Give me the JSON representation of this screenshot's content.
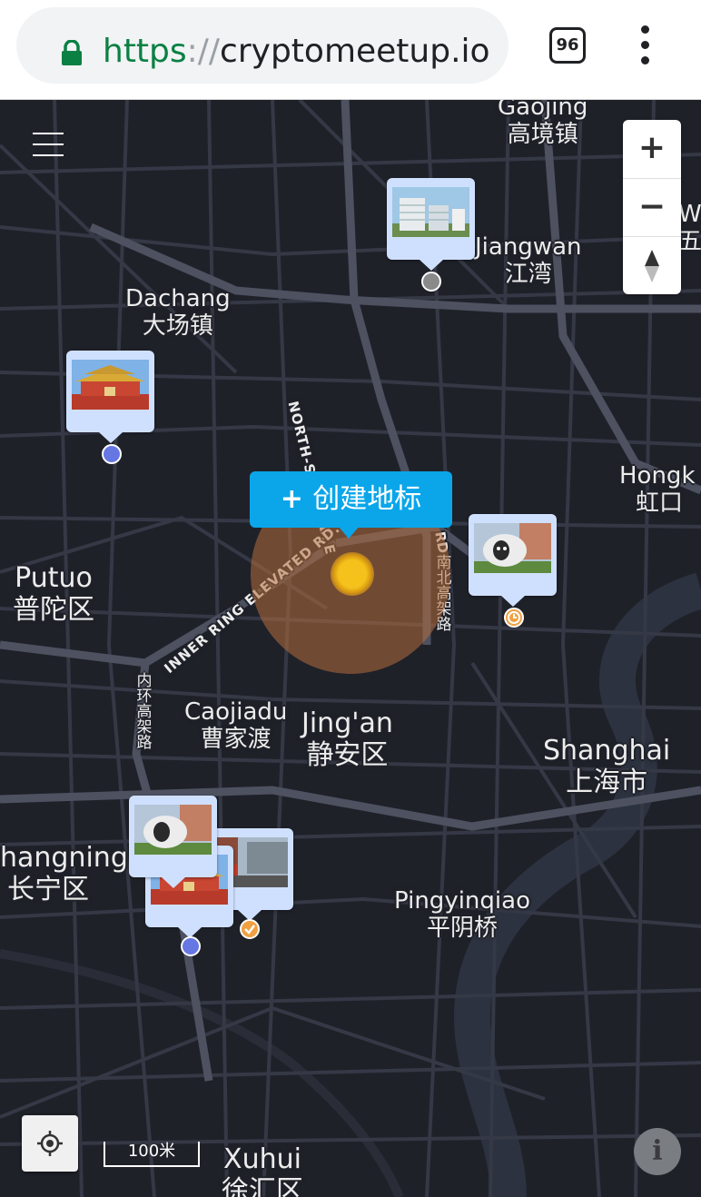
{
  "browser": {
    "url_scheme": "https",
    "url_sep": "://",
    "url_host": "cryptomeetup.io",
    "tab_count": "96"
  },
  "map": {
    "labels": {
      "gaojing_en": "Gaojing",
      "gaojing_zh": "高境镇",
      "jiangwan_en": "Jiangwan",
      "jiangwan_zh": "江湾",
      "dachang_en": "Dachang",
      "dachang_zh": "大场镇",
      "hongkou_en": "Hongk",
      "hongkou_zh": "虹口",
      "putuo_en": "Putuo",
      "putuo_zh": "普陀区",
      "caojiadu_en": "Caojiadu",
      "caojiadu_zh": "曹家渡",
      "jingan_en": "Jing'an",
      "jingan_zh": "静安区",
      "shanghai_en": "Shanghai",
      "shanghai_zh": "上海市",
      "changning_en": "hangning",
      "changning_zh": "长宁区",
      "pingyinqiao_en": "Pingyinqiao",
      "pingyinqiao_zh": "平阴桥",
      "xuhui_en": "Xuhui",
      "xuhui_zh": "徐汇区",
      "wu_en": "Wu",
      "wu_zh": "五",
      "road_north_south": "NORTH-SOUTH ELE",
      "road_north_south_tail": "RD.",
      "road_north_south_zh": "南北高架路",
      "road_inner_ring": "INNER RING ELEVATED RD.",
      "road_inner_ring_zh": "内环高架路"
    },
    "create_button": "创建地标",
    "scale_label": "100米",
    "markers": [
      {
        "name": "modern-building",
        "status": "gray"
      },
      {
        "name": "gate-tower",
        "status": "blue"
      },
      {
        "name": "sheep-sculpture",
        "status": "pending"
      },
      {
        "name": "sheep-sculpture-cluster",
        "status": "cluster"
      },
      {
        "name": "street-scene",
        "status": "done"
      },
      {
        "name": "gate-tower-cluster",
        "status": "blue"
      }
    ],
    "colors": {
      "background": "#1f2129",
      "road": "#3b3e4a",
      "major_road": "#4d5160",
      "create_button": "#0aa6e9",
      "marker_bg": "#cfe0ff",
      "dot_blue": "#6676e3",
      "dot_gray": "#8a8a8a",
      "dot_orange": "#f0a040"
    }
  }
}
